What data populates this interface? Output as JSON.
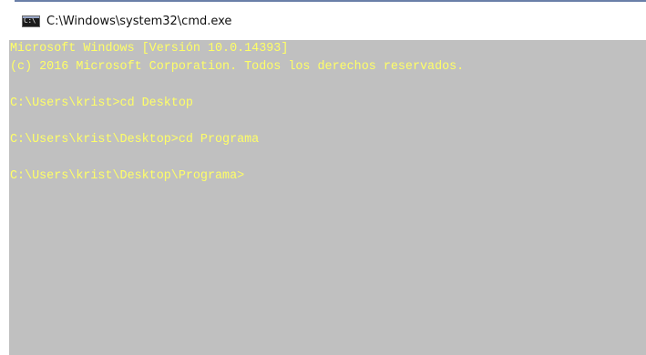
{
  "window": {
    "title": "C:\\Windows\\system32\\cmd.exe",
    "icon": "cmd-icon"
  },
  "console": {
    "background_color": "#c0c0c0",
    "text_color": "#ffff66",
    "lines": [
      "Microsoft Windows [Versión 10.0.14393]",
      "(c) 2016 Microsoft Corporation. Todos los derechos reservados.",
      "",
      "C:\\Users\\krist>cd Desktop",
      "",
      "C:\\Users\\krist\\Desktop>cd Programa",
      "",
      "C:\\Users\\krist\\Desktop\\Programa>"
    ]
  }
}
